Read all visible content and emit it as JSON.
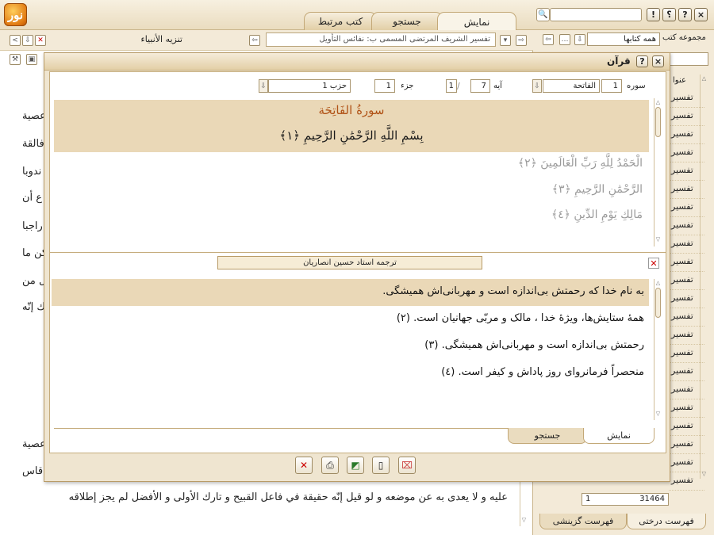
{
  "topbar": {
    "logo_text": "نور",
    "tabs": {
      "display": "نمایش",
      "search": "جستجو",
      "related": "کتب مرتبط"
    },
    "search_icon": "magnifier-icon",
    "buttons": {
      "info": "!",
      "help": "؟",
      "close": "×"
    }
  },
  "left_doc": {
    "title": "تنزيه الأنبياء",
    "path": "تفسير الشريف المرتضى المسمى ب: نفائس التأويل",
    "lines": [
      "عصية",
      "فالقة",
      "ندوبا",
      "ع أن",
      "راجبا",
      "كن ما",
      "ل من",
      "ك إنّه",
      "عصية",
      "قاس"
    ],
    "last_line": "عليه و لا يعدى به عن موضعه و لو قيل إنّه حقيقة في فاعل القبيح و تارك الأولى و الأفضل لم يجز إطلاقه"
  },
  "sidebar": {
    "label": "مجموعه کتب",
    "select_value": "همه کتابها",
    "column_header": "عنوا",
    "items": [
      "تفسير",
      "تفسير",
      "تفسير",
      "تفسير",
      "تفسير",
      "تفسير",
      "تفسير",
      "تفسير",
      "تفسير",
      "تفسير",
      "تفسير",
      "تفسير",
      "تفسير",
      "تفسير",
      "تفسير",
      "تفسير",
      "تفسير",
      "تفسير",
      "تفسير",
      "تفسير",
      "تفسير",
      "تفسير"
    ],
    "counter_current": "1",
    "counter_total": "31464",
    "tab_tree": "فهرست درختی",
    "tab_select": "فهرست گزینشی"
  },
  "dialog": {
    "title": "قرآن",
    "surah_label": "سوره",
    "surah_number": "1",
    "surah_name": "الفاتحة",
    "ayah_label": "آیه",
    "ayah_from": "7",
    "ayah_to": "1",
    "juz_label": "جزء",
    "juz_value": "1",
    "hizb_value": "حزب 1",
    "surah_header": "سورةُ الفَاتِحَة",
    "basmala": "بِسْمِ اللَّهِ الرَّحْمَٰنِ الرَّحِيمِ ﴿١﴾",
    "verses": [
      "الْحَمْدُ لِلَّهِ رَبِّ الْعَالَمِينَ ﴿٢﴾",
      "الرَّحْمَٰنِ الرَّحِيمِ ﴿٣﴾",
      "مَالِكِ يَوْمِ الدِّينِ ﴿٤﴾"
    ],
    "translation_title": "ترجمه استاد حسين انصاريان",
    "translations": [
      "به نام خدا كه رحمتش بی‌اندازه است و مهربانی‌اش همیشگی.",
      "همهٔ ستایش‌ها، ویژهٔ خدا ، مالک و مربّی جهانیان است. (٢)",
      "رحمتش بی‌اندازه است و مهربانی‌اش همیشگی. (٣)",
      "منحصراً فرمانروای روز پاداش و کیفر است. (٤)"
    ],
    "tab_display": "نمایش",
    "tab_search": "جستجو"
  }
}
